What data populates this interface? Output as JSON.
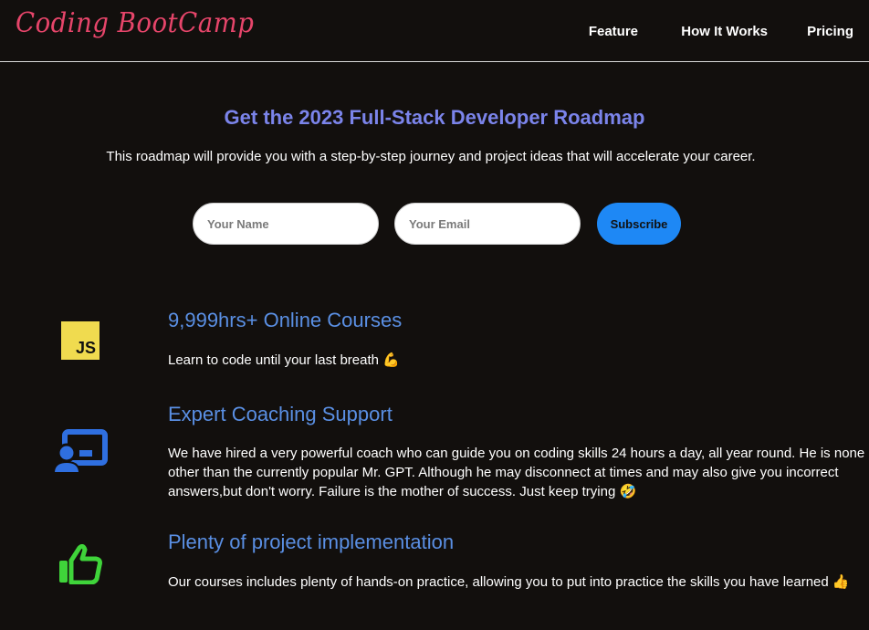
{
  "header": {
    "logo": "Coding BootCamp",
    "nav": [
      "Feature",
      "How It Works",
      "Pricing"
    ]
  },
  "hero": {
    "title": "Get the 2023 Full-Stack Developer Roadmap",
    "subtitle": "This roadmap will provide you with a step-by-step journey and project ideas that will accelerate your career."
  },
  "form": {
    "name_placeholder": "Your Name",
    "email_placeholder": "Your Email",
    "subscribe_label": "Subscribe"
  },
  "features": [
    {
      "icon": "javascript-icon",
      "title": "9,999hrs+ Online Courses",
      "desc": "Learn to code until your last breath 💪"
    },
    {
      "icon": "coach-presentation-icon",
      "title": "Expert Coaching Support",
      "desc": "We have hired a very powerful coach who can guide you on coding skills 24 hours a day, all year round. He is none other than the currently popular Mr. GPT. Although he may disconnect at times and may also give you incorrect answers,but don't worry. Failure is the mother of success. Just keep trying 🤣"
    },
    {
      "icon": "thumbs-up-icon",
      "title": "Plenty of project implementation",
      "desc": "Our courses includes plenty of hands-on practice, allowing you to put into practice the skills you have learned 👍"
    }
  ],
  "colors": {
    "background": "#120f0d",
    "logo": "#e6456a",
    "hero_title": "#7b84ea",
    "feature_title": "#5a8fe3",
    "subscribe_button": "#1e88f5",
    "coach_icon": "#2f6fe0",
    "thumbs_icon": "#3fd43a",
    "js_icon": "#f0db4f"
  }
}
